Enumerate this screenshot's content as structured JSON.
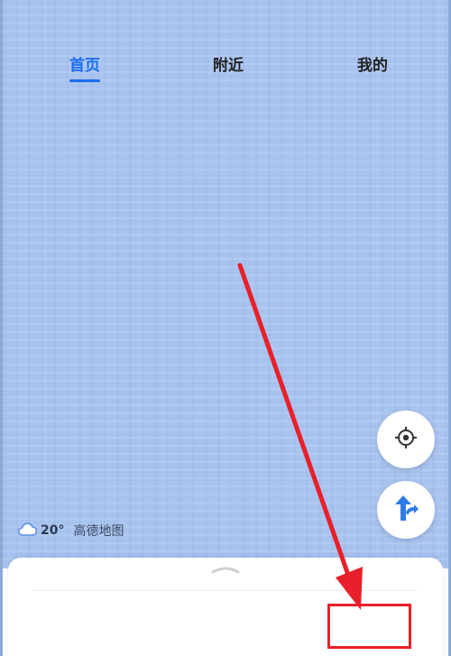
{
  "weather": {
    "temperature": "20°",
    "brand": "高德地图",
    "icon": "cloud-icon"
  },
  "map_controls": {
    "locate_icon": "locate-crosshair-icon",
    "route_icon": "route-arrow-icon"
  },
  "bottom_nav": {
    "tabs": [
      {
        "label": "首页",
        "active": true
      },
      {
        "label": "附近",
        "active": false
      },
      {
        "label": "我的",
        "active": false
      }
    ]
  },
  "colors": {
    "map_background": "#a9c3ef",
    "accent": "#1a6ef0",
    "annotation": "#e8202a"
  }
}
